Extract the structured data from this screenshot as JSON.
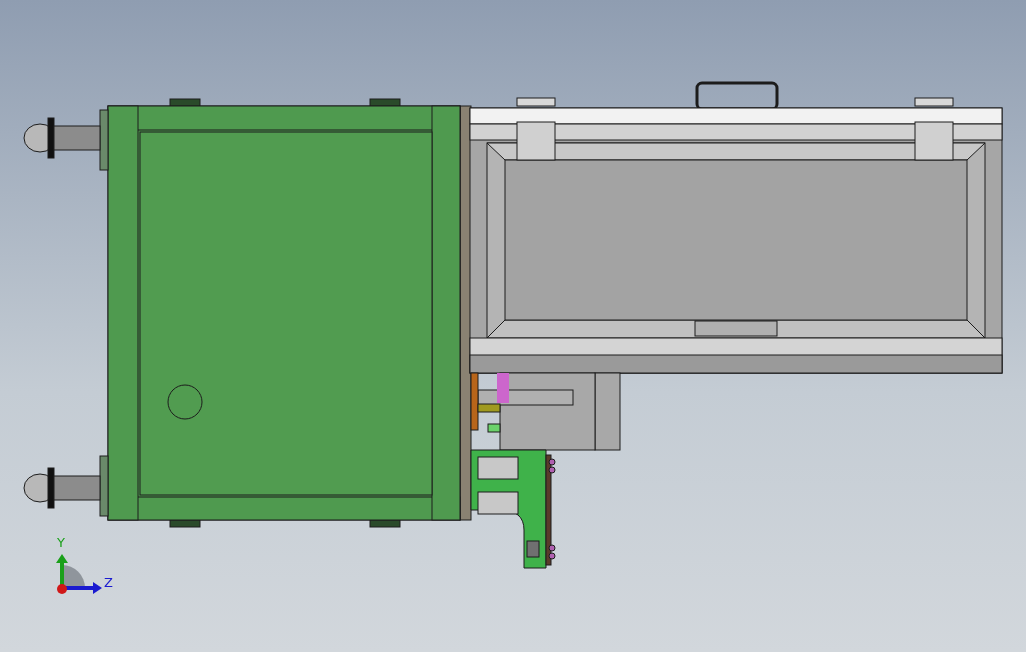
{
  "viewport": {
    "triad": {
      "axes": [
        {
          "kind": "vertical",
          "label": "Y",
          "color": "#1aa01a"
        },
        {
          "kind": "horizontal",
          "label": "Z",
          "color": "#1a1ad0"
        }
      ]
    }
  }
}
